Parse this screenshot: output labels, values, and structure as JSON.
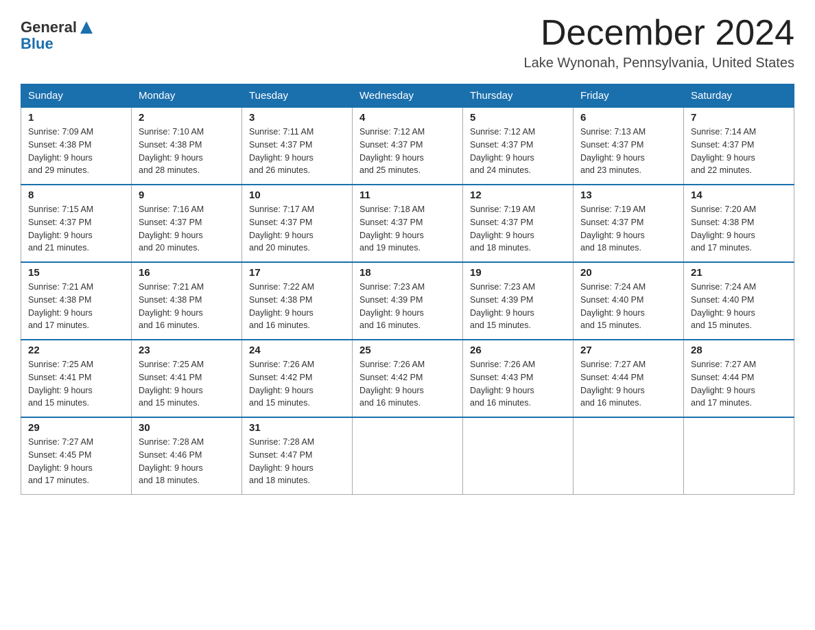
{
  "header": {
    "logo_line1": "General",
    "logo_line2": "Blue",
    "month_title": "December 2024",
    "location": "Lake Wynonah, Pennsylvania, United States"
  },
  "weekdays": [
    "Sunday",
    "Monday",
    "Tuesday",
    "Wednesday",
    "Thursday",
    "Friday",
    "Saturday"
  ],
  "weeks": [
    [
      {
        "day": "1",
        "sunrise": "7:09 AM",
        "sunset": "4:38 PM",
        "daylight": "9 hours and 29 minutes."
      },
      {
        "day": "2",
        "sunrise": "7:10 AM",
        "sunset": "4:38 PM",
        "daylight": "9 hours and 28 minutes."
      },
      {
        "day": "3",
        "sunrise": "7:11 AM",
        "sunset": "4:37 PM",
        "daylight": "9 hours and 26 minutes."
      },
      {
        "day": "4",
        "sunrise": "7:12 AM",
        "sunset": "4:37 PM",
        "daylight": "9 hours and 25 minutes."
      },
      {
        "day": "5",
        "sunrise": "7:12 AM",
        "sunset": "4:37 PM",
        "daylight": "9 hours and 24 minutes."
      },
      {
        "day": "6",
        "sunrise": "7:13 AM",
        "sunset": "4:37 PM",
        "daylight": "9 hours and 23 minutes."
      },
      {
        "day": "7",
        "sunrise": "7:14 AM",
        "sunset": "4:37 PM",
        "daylight": "9 hours and 22 minutes."
      }
    ],
    [
      {
        "day": "8",
        "sunrise": "7:15 AM",
        "sunset": "4:37 PM",
        "daylight": "9 hours and 21 minutes."
      },
      {
        "day": "9",
        "sunrise": "7:16 AM",
        "sunset": "4:37 PM",
        "daylight": "9 hours and 20 minutes."
      },
      {
        "day": "10",
        "sunrise": "7:17 AM",
        "sunset": "4:37 PM",
        "daylight": "9 hours and 20 minutes."
      },
      {
        "day": "11",
        "sunrise": "7:18 AM",
        "sunset": "4:37 PM",
        "daylight": "9 hours and 19 minutes."
      },
      {
        "day": "12",
        "sunrise": "7:19 AM",
        "sunset": "4:37 PM",
        "daylight": "9 hours and 18 minutes."
      },
      {
        "day": "13",
        "sunrise": "7:19 AM",
        "sunset": "4:37 PM",
        "daylight": "9 hours and 18 minutes."
      },
      {
        "day": "14",
        "sunrise": "7:20 AM",
        "sunset": "4:38 PM",
        "daylight": "9 hours and 17 minutes."
      }
    ],
    [
      {
        "day": "15",
        "sunrise": "7:21 AM",
        "sunset": "4:38 PM",
        "daylight": "9 hours and 17 minutes."
      },
      {
        "day": "16",
        "sunrise": "7:21 AM",
        "sunset": "4:38 PM",
        "daylight": "9 hours and 16 minutes."
      },
      {
        "day": "17",
        "sunrise": "7:22 AM",
        "sunset": "4:38 PM",
        "daylight": "9 hours and 16 minutes."
      },
      {
        "day": "18",
        "sunrise": "7:23 AM",
        "sunset": "4:39 PM",
        "daylight": "9 hours and 16 minutes."
      },
      {
        "day": "19",
        "sunrise": "7:23 AM",
        "sunset": "4:39 PM",
        "daylight": "9 hours and 15 minutes."
      },
      {
        "day": "20",
        "sunrise": "7:24 AM",
        "sunset": "4:40 PM",
        "daylight": "9 hours and 15 minutes."
      },
      {
        "day": "21",
        "sunrise": "7:24 AM",
        "sunset": "4:40 PM",
        "daylight": "9 hours and 15 minutes."
      }
    ],
    [
      {
        "day": "22",
        "sunrise": "7:25 AM",
        "sunset": "4:41 PM",
        "daylight": "9 hours and 15 minutes."
      },
      {
        "day": "23",
        "sunrise": "7:25 AM",
        "sunset": "4:41 PM",
        "daylight": "9 hours and 15 minutes."
      },
      {
        "day": "24",
        "sunrise": "7:26 AM",
        "sunset": "4:42 PM",
        "daylight": "9 hours and 15 minutes."
      },
      {
        "day": "25",
        "sunrise": "7:26 AM",
        "sunset": "4:42 PM",
        "daylight": "9 hours and 16 minutes."
      },
      {
        "day": "26",
        "sunrise": "7:26 AM",
        "sunset": "4:43 PM",
        "daylight": "9 hours and 16 minutes."
      },
      {
        "day": "27",
        "sunrise": "7:27 AM",
        "sunset": "4:44 PM",
        "daylight": "9 hours and 16 minutes."
      },
      {
        "day": "28",
        "sunrise": "7:27 AM",
        "sunset": "4:44 PM",
        "daylight": "9 hours and 17 minutes."
      }
    ],
    [
      {
        "day": "29",
        "sunrise": "7:27 AM",
        "sunset": "4:45 PM",
        "daylight": "9 hours and 17 minutes."
      },
      {
        "day": "30",
        "sunrise": "7:28 AM",
        "sunset": "4:46 PM",
        "daylight": "9 hours and 18 minutes."
      },
      {
        "day": "31",
        "sunrise": "7:28 AM",
        "sunset": "4:47 PM",
        "daylight": "9 hours and 18 minutes."
      },
      null,
      null,
      null,
      null
    ]
  ],
  "labels": {
    "sunrise": "Sunrise:",
    "sunset": "Sunset:",
    "daylight": "Daylight:"
  }
}
